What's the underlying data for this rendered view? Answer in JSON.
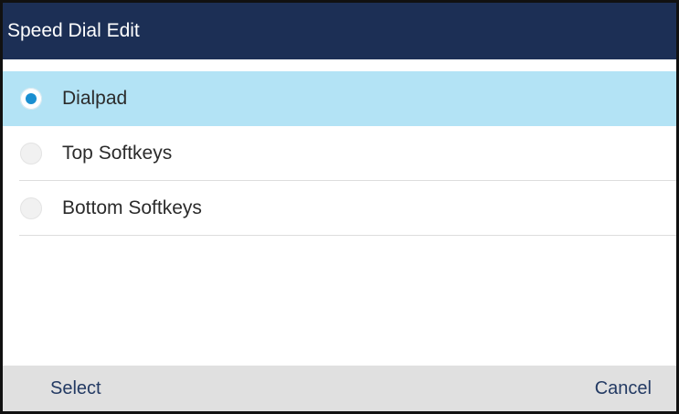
{
  "header": {
    "title": "Speed Dial Edit"
  },
  "options": [
    {
      "label": "Dialpad",
      "selected": true
    },
    {
      "label": "Top Softkeys",
      "selected": false
    },
    {
      "label": "Bottom Softkeys",
      "selected": false
    }
  ],
  "softkeys": {
    "select_label": "Select",
    "cancel_label": "Cancel"
  },
  "colors": {
    "title_bar": "#1c2f55",
    "selected_row": "#b3e3f5",
    "radio_dot": "#1a8fd1",
    "softkey_bar": "#e0e0e0",
    "softkey_text": "#233a63"
  }
}
